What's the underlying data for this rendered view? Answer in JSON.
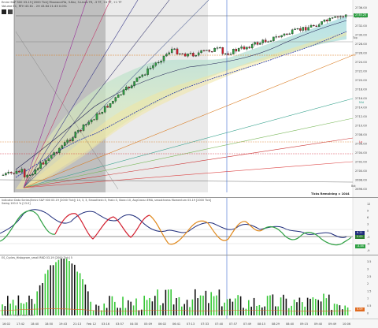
{
  "colors": {
    "up": "#2ea043",
    "down": "#d21f2f",
    "price_badge": "#2f9e44",
    "osc_line": "#1d2b7a",
    "osc_zero_badge": "#2e7d32",
    "hist_green": "#37c837",
    "hist_black": "#111111"
  },
  "top_panel": {
    "info_line_1": "Emini S&P 500 03-19 [2000 Tick] FibonacciFib, 3-Bar, 3-Lines TR, -3 TF, +4 TF, +1 TF",
    "info_line_2": "Volume EC, RTH 43.61 - 2H 43.64 21:43 0.051",
    "timer_label": "Ticks Remaining = 1044",
    "level_labels": [
      {
        "text": "Top",
        "label_color": "#7a7a7a"
      },
      {
        "text": "Hi",
        "label_color": "#d97a1f"
      },
      {
        "text": "Mid",
        "label_color": "#7a7a7a"
      },
      {
        "text": "Lo",
        "label_color": "#d21f2f"
      },
      {
        "text": "Bot",
        "label_color": "#7a7a7a"
      }
    ],
    "price_axis": [
      "2736.00",
      "2734.00",
      "2732.00",
      "2730.00",
      "2728.00",
      "2726.00",
      "2724.00",
      "2722.00",
      "2720.00",
      "2718.00",
      "2716.00",
      "2714.00",
      "2712.00",
      "2710.00",
      "2708.00",
      "2706.00",
      "2704.00",
      "2702.00",
      "2700.00",
      "2698.00",
      "2696.00"
    ],
    "current_price": "2735.25"
  },
  "mid_panel": {
    "info_line_1": "Indicator Data Series(Emini S&P 500 03-19 [2000 Tick]) 14, 3, 3, Smoothed=3, Fast=3, Slow=10, AvgCross=EMA, smoothness Momentum 03-19 [2000 Tick]",
    "info_line_2": "Swing 100.0 % [13.0]",
    "axis": [
      "12",
      "9",
      "6",
      "3",
      "0",
      "-3",
      "-6",
      "-9"
    ],
    "badges": [
      {
        "text": "6.21",
        "bg": "#1d2b7a"
      },
      {
        "text": "0.00",
        "bg": "#2e7d32"
      },
      {
        "text": "-4.44",
        "bg": "#2ea043"
      }
    ]
  },
  "bottom_panel": {
    "info_line_1": "ES_Cycles_Histogram_small RND 03-19 [2000 Tick] 5",
    "axis": [
      "3.5",
      "3",
      "2.5",
      "2",
      "1.5",
      "1",
      "0.5",
      "0"
    ],
    "badge": {
      "text": "0.09",
      "bg": "#e06a1f"
    },
    "copyright": "© 2019 NinjaTrader, LLC"
  },
  "time_axis": [
    "16:02",
    "17:42",
    "18:40",
    "18:50",
    "19:43",
    "21:13",
    "Feb 12",
    "03:16",
    "03:57",
    "04:30",
    "05:09",
    "06:02",
    "06:41",
    "07:13",
    "07:33",
    "07:40",
    "07:57",
    "07:49",
    "08:15",
    "08:29",
    "08:40",
    "09:15",
    "09:40",
    "09:49",
    "10:06"
  ]
}
